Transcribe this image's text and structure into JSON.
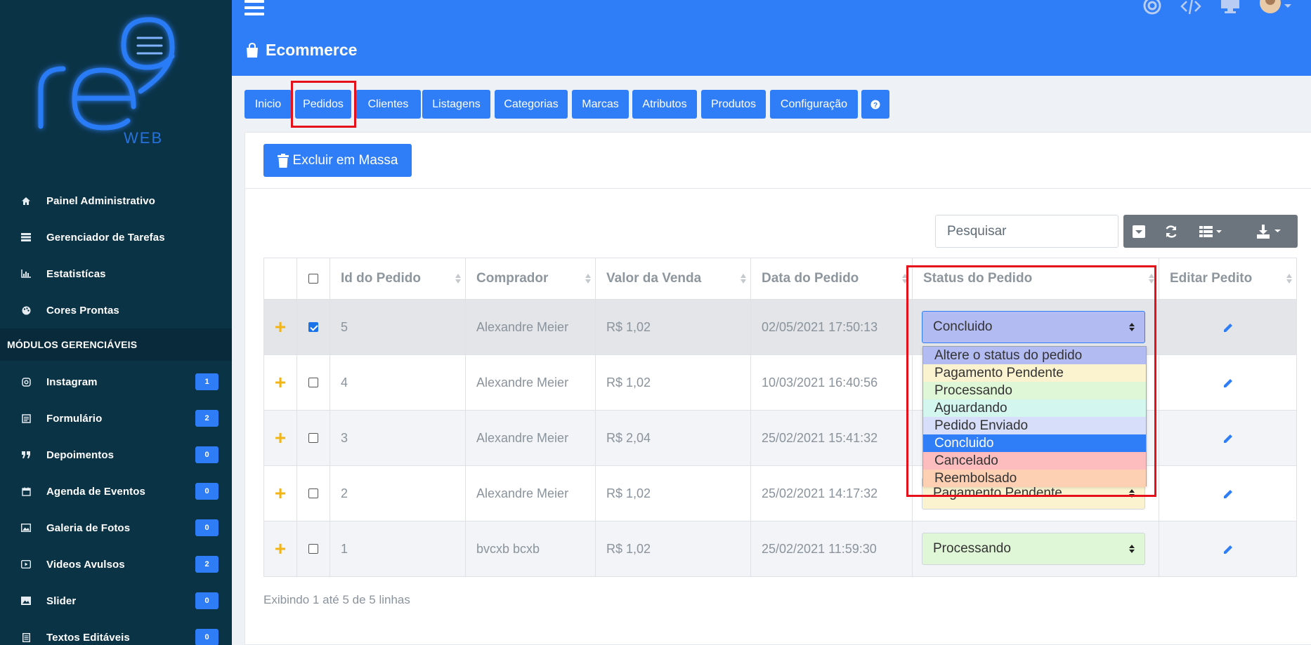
{
  "sidebar": {
    "logo_text": "re9 WEB",
    "items": [
      {
        "label": "Painel Administrativo",
        "icon": "home-icon"
      },
      {
        "label": "Gerenciador de Tarefas",
        "icon": "tasks-icon"
      },
      {
        "label": "Estatistícas",
        "icon": "chart-icon"
      },
      {
        "label": "Cores Prontas",
        "icon": "palette-icon"
      }
    ],
    "section_title": "MÓDULOS GERENCIÁVEIS",
    "modules": [
      {
        "label": "Instagram",
        "badge": "1",
        "icon": "instagram-icon"
      },
      {
        "label": "Formulário",
        "badge": "2",
        "icon": "form-icon"
      },
      {
        "label": "Depoimentos",
        "badge": "0",
        "icon": "quote-icon"
      },
      {
        "label": "Agenda de Eventos",
        "badge": "0",
        "icon": "calendar-icon"
      },
      {
        "label": "Galeria de Fotos",
        "badge": "0",
        "icon": "image-icon"
      },
      {
        "label": "Videos Avulsos",
        "badge": "2",
        "icon": "video-icon"
      },
      {
        "label": "Slider",
        "badge": "0",
        "icon": "slider-icon"
      },
      {
        "label": "Textos Editáveis",
        "badge": "0",
        "icon": "document-icon"
      }
    ]
  },
  "header": {
    "title": "Ecommerce"
  },
  "tabs": [
    "Inicio",
    "Pedidos",
    "Clientes",
    "Listagens",
    "Categorias",
    "Marcas",
    "Atributos",
    "Produtos",
    "Configuração"
  ],
  "toolbar": {
    "bulk_delete": "Excluir em Massa",
    "search_placeholder": "Pesquisar"
  },
  "table": {
    "columns": [
      "Id do Pedido",
      "Comprador",
      "Valor da Venda",
      "Data do Pedido",
      "Status do Pedido",
      "Editar Pedito"
    ],
    "rows": [
      {
        "id": "5",
        "buyer": "Alexandre Meier",
        "value": "R$ 1,02",
        "date": "02/05/2021 17:50:13",
        "status": "Concluido",
        "checked": true
      },
      {
        "id": "4",
        "buyer": "Alexandre Meier",
        "value": "R$ 1,02",
        "date": "10/03/2021 16:40:56",
        "status": "",
        "checked": false
      },
      {
        "id": "3",
        "buyer": "Alexandre Meier",
        "value": "R$ 2,04",
        "date": "25/02/2021 15:41:32",
        "status": "",
        "checked": false
      },
      {
        "id": "2",
        "buyer": "Alexandre Meier",
        "value": "R$ 1,02",
        "date": "25/02/2021 14:17:32",
        "status": "Pagamento Pendente",
        "checked": false
      },
      {
        "id": "1",
        "buyer": "bvcxb bcxb",
        "value": "R$ 1,02",
        "date": "25/02/2021 11:59:30",
        "status": "Processando",
        "checked": false
      }
    ]
  },
  "status_options": [
    {
      "label": "Altere o status do pedido",
      "color": "#b3bbf3"
    },
    {
      "label": "Pagamento Pendente",
      "color": "#fbf3cf"
    },
    {
      "label": "Processando",
      "color": "#dff7d6"
    },
    {
      "label": "Aguardando",
      "color": "#d3f6ef"
    },
    {
      "label": "Pedido Enviado",
      "color": "#d6def9"
    },
    {
      "label": "Concluido",
      "color": "#2f7ef7"
    },
    {
      "label": "Cancelado",
      "color": "#fdbdbf"
    },
    {
      "label": "Reembolsado",
      "color": "#fdd0b3"
    }
  ],
  "pagination": {
    "summary": "Exibindo 1 até 5 de 5 linhas"
  },
  "colors": {
    "primary": "#2f7ef7",
    "sidebar": "#0b3346",
    "highlight": "#e6101b",
    "plus": "#f3b416"
  }
}
